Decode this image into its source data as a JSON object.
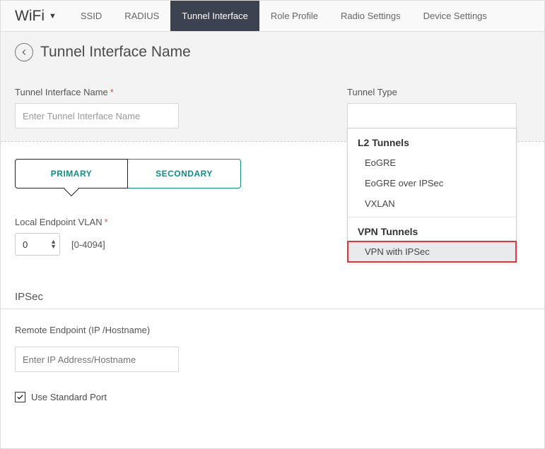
{
  "brand": "WiFi",
  "nav": {
    "tabs": [
      {
        "label": "SSID"
      },
      {
        "label": "RADIUS"
      },
      {
        "label": "Tunnel Interface",
        "active": true
      },
      {
        "label": "Role Profile"
      },
      {
        "label": "Radio Settings"
      },
      {
        "label": "Device Settings"
      }
    ]
  },
  "page": {
    "title": "Tunnel Interface Name"
  },
  "form": {
    "name_label": "Tunnel Interface Name",
    "name_placeholder": "Enter Tunnel Interface Name",
    "name_value": "",
    "tunnel_type_label": "Tunnel Type",
    "tunnel_type_value": "",
    "tunnel_dropdown": {
      "group1_label": "L2 Tunnels",
      "group1_options": [
        "EoGRE",
        "EoGRE over IPSec",
        "VXLAN"
      ],
      "group2_label": "VPN Tunnels",
      "group2_options": [
        "VPN with IPSec"
      ]
    }
  },
  "subnav": {
    "primary": "PRIMARY",
    "secondary": "SECONDARY"
  },
  "vlan": {
    "label": "Local Endpoint VLAN",
    "value": "0",
    "hint": "[0-4094]"
  },
  "ipsec": {
    "section_label": "IPSec",
    "remote_label": "Remote Endpoint (IP /Hostname)",
    "remote_placeholder": "Enter IP Address/Hostname",
    "remote_value": "",
    "use_standard_port_label": "Use Standard Port",
    "use_standard_port_checked": true
  }
}
